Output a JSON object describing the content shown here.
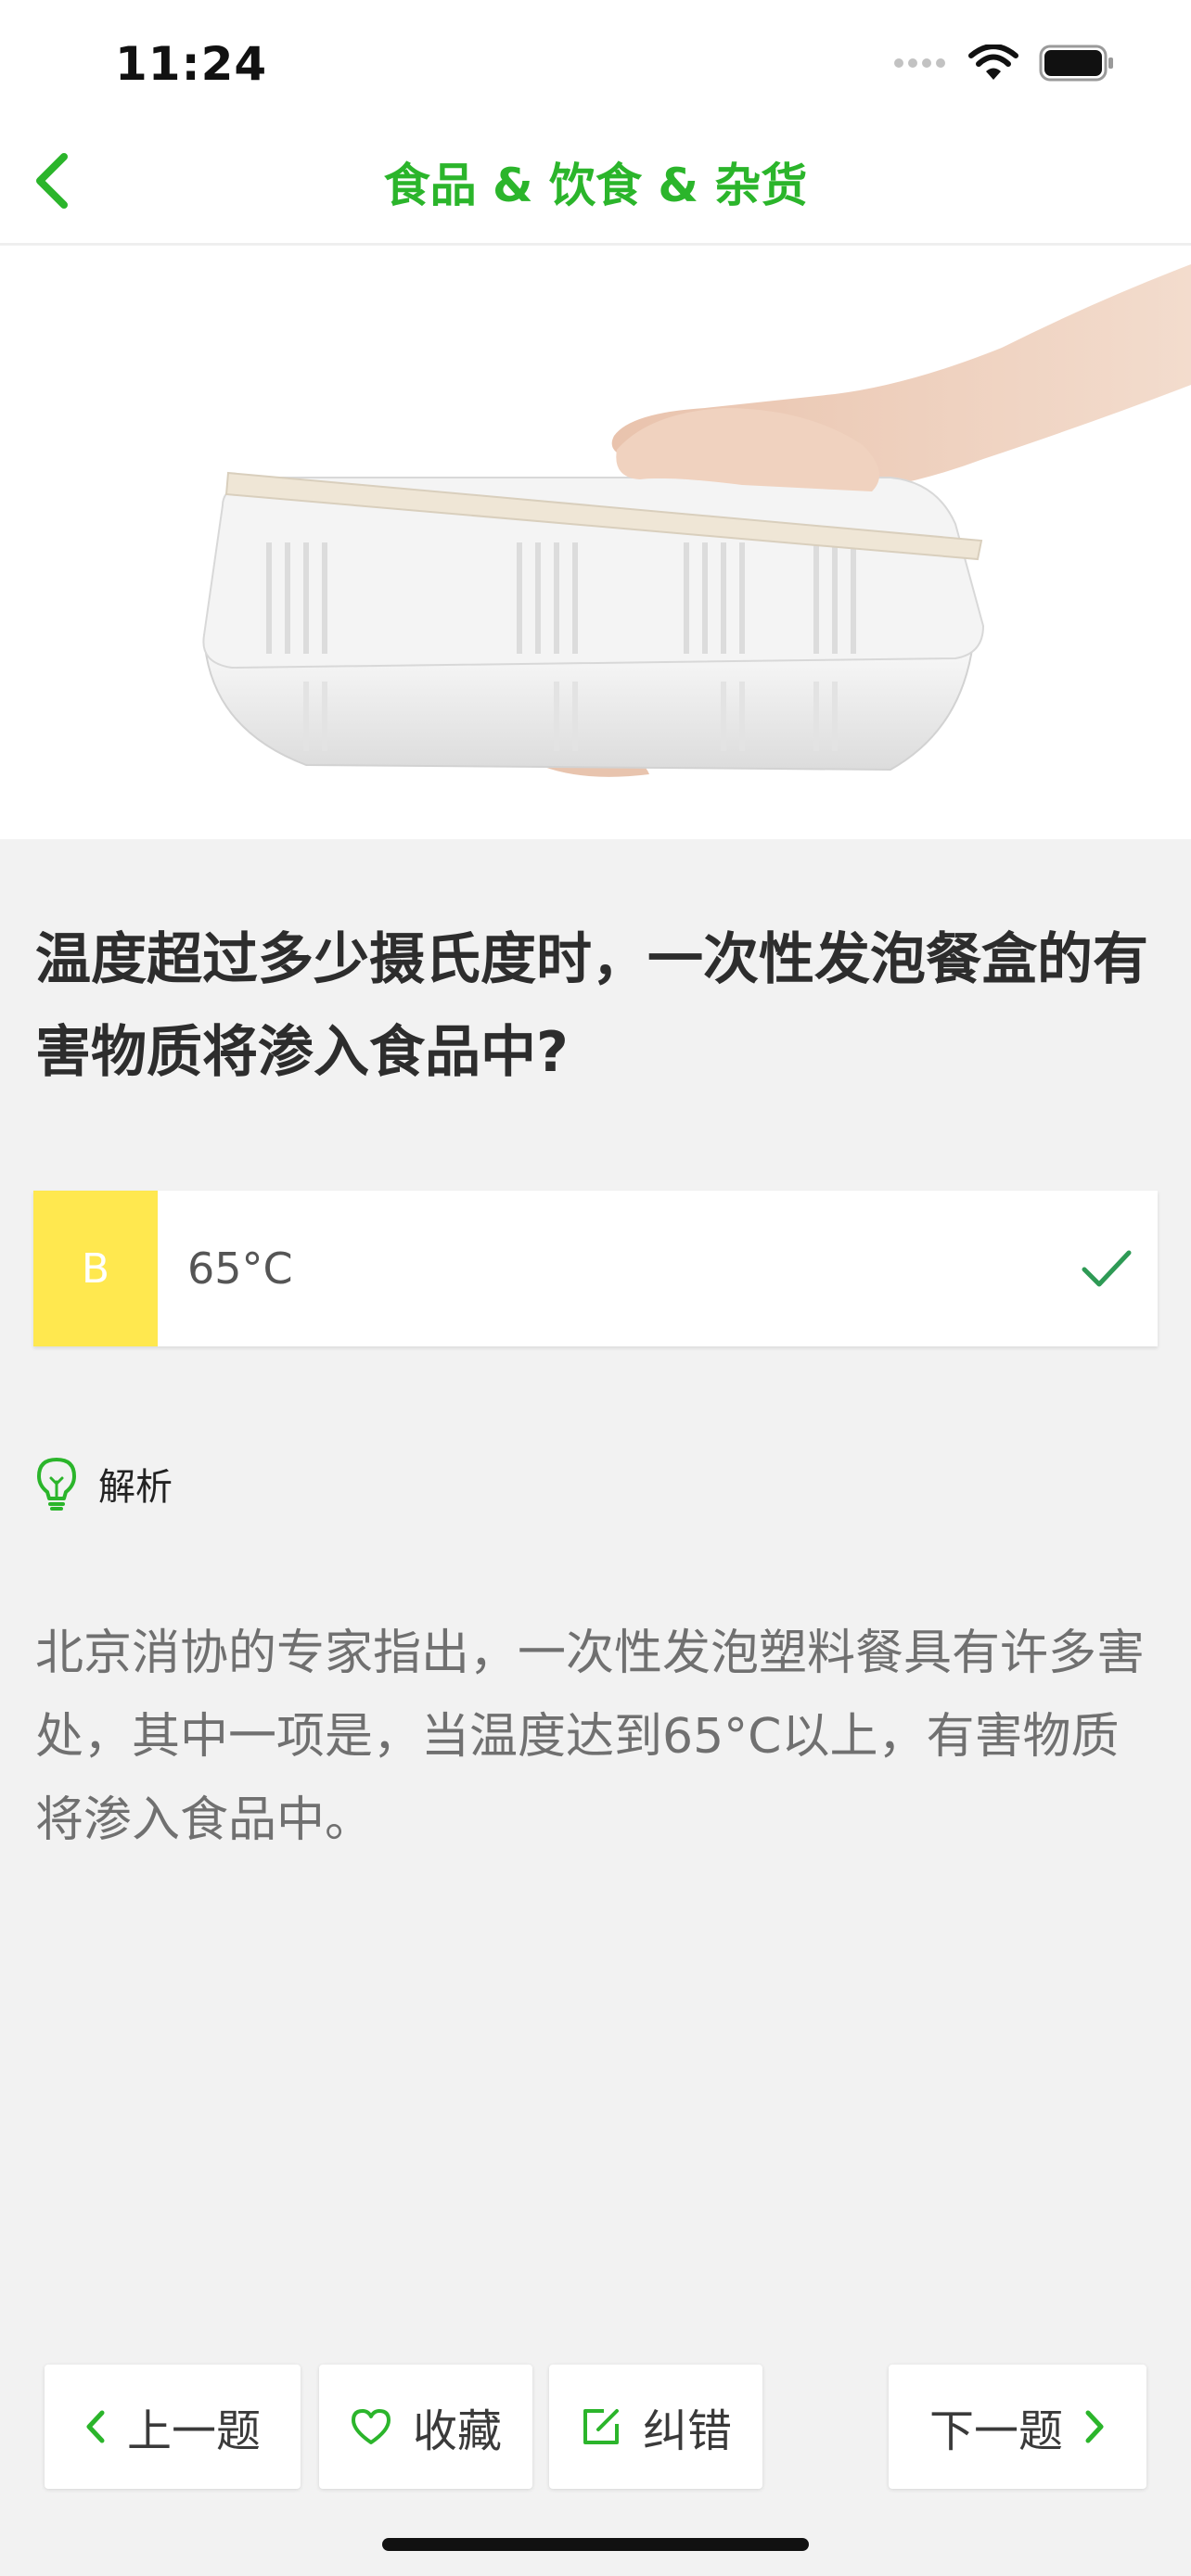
{
  "status_bar": {
    "time": "11:24"
  },
  "nav": {
    "title": "食品 & 饮食 & 杂货"
  },
  "question": {
    "text": "温度超过多少摄氏度时，一次性发泡餐盒的有害物质将渗入食品中?"
  },
  "answer": {
    "letter": "B",
    "text": "65°C"
  },
  "analysis": {
    "label": "解析",
    "text": "北京消协的专家指出，一次性发泡塑料餐具有许多害处，其中一项是，当温度达到65°C以上，有害物质将渗入食品中。"
  },
  "toolbar": {
    "prev_label": "上一题",
    "favorite_label": "收藏",
    "report_label": "纠错",
    "next_label": "下一题"
  },
  "colors": {
    "accent": "#2bb52b",
    "answer_badge": "#ffe84f",
    "check": "#2e9a55"
  }
}
